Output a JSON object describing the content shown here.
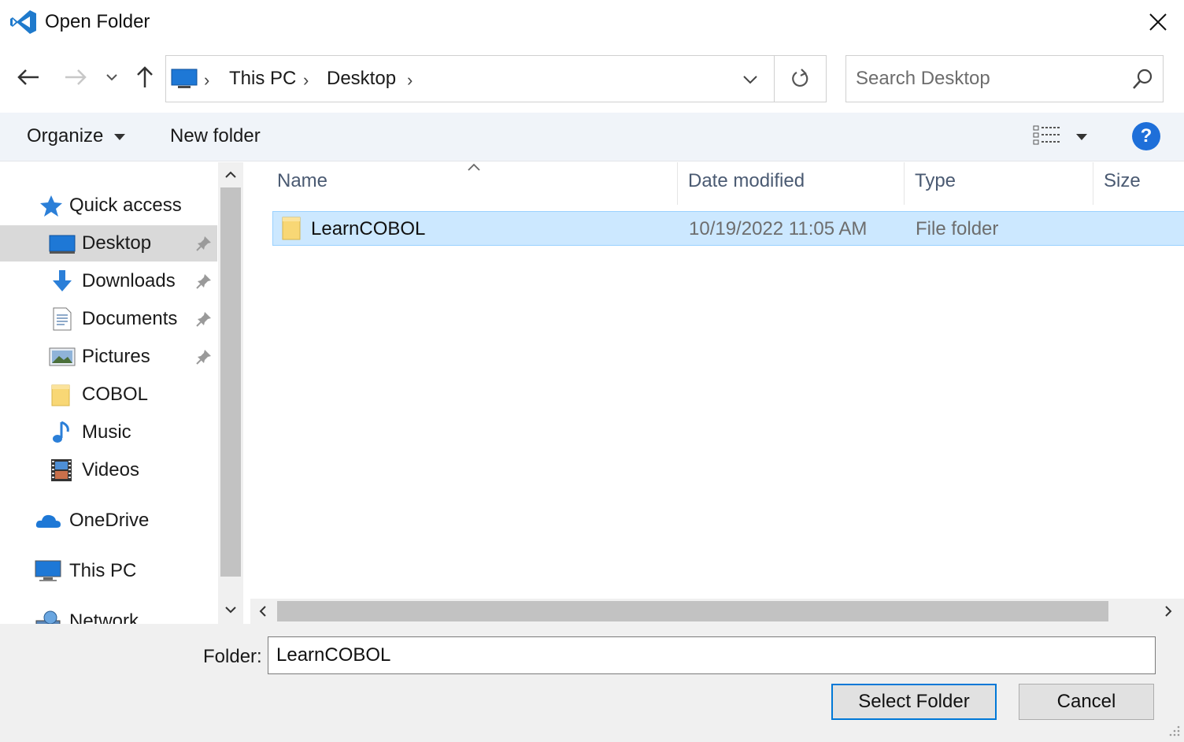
{
  "window": {
    "title": "Open Folder"
  },
  "address": {
    "breadcrumbs": [
      "This PC",
      "Desktop"
    ]
  },
  "search": {
    "placeholder": "Search Desktop"
  },
  "toolbar": {
    "organize": "Organize",
    "new_folder": "New folder",
    "help": "?"
  },
  "nav": {
    "items": [
      {
        "label": "Quick access",
        "icon": "star-icon"
      },
      {
        "label": "Desktop",
        "icon": "desktop-icon",
        "pinned": true,
        "selected": true
      },
      {
        "label": "Downloads",
        "icon": "download-icon",
        "pinned": true
      },
      {
        "label": "Documents",
        "icon": "document-icon",
        "pinned": true
      },
      {
        "label": "Pictures",
        "icon": "pictures-icon",
        "pinned": true
      },
      {
        "label": "COBOL",
        "icon": "folder-icon"
      },
      {
        "label": "Music",
        "icon": "music-icon"
      },
      {
        "label": "Videos",
        "icon": "video-icon"
      },
      {
        "label": "OneDrive",
        "icon": "cloud-icon"
      },
      {
        "label": "This PC",
        "icon": "computer-icon"
      },
      {
        "label": "Network",
        "icon": "network-icon"
      }
    ]
  },
  "files": {
    "columns": [
      "Name",
      "Date modified",
      "Type",
      "Size"
    ],
    "rows": [
      {
        "name": "LearnCOBOL",
        "date_modified": "10/19/2022 11:05 AM",
        "type": "File folder",
        "size": ""
      }
    ]
  },
  "footer": {
    "folder_label": "Folder:",
    "folder_value": "LearnCOBOL",
    "select_button": "Select Folder",
    "cancel_button": "Cancel"
  },
  "colors": {
    "accent": "#0078d7",
    "selection": "#cce8ff",
    "toolbar_bg": "#f0f4f9",
    "help_blue": "#1e6fd9"
  }
}
